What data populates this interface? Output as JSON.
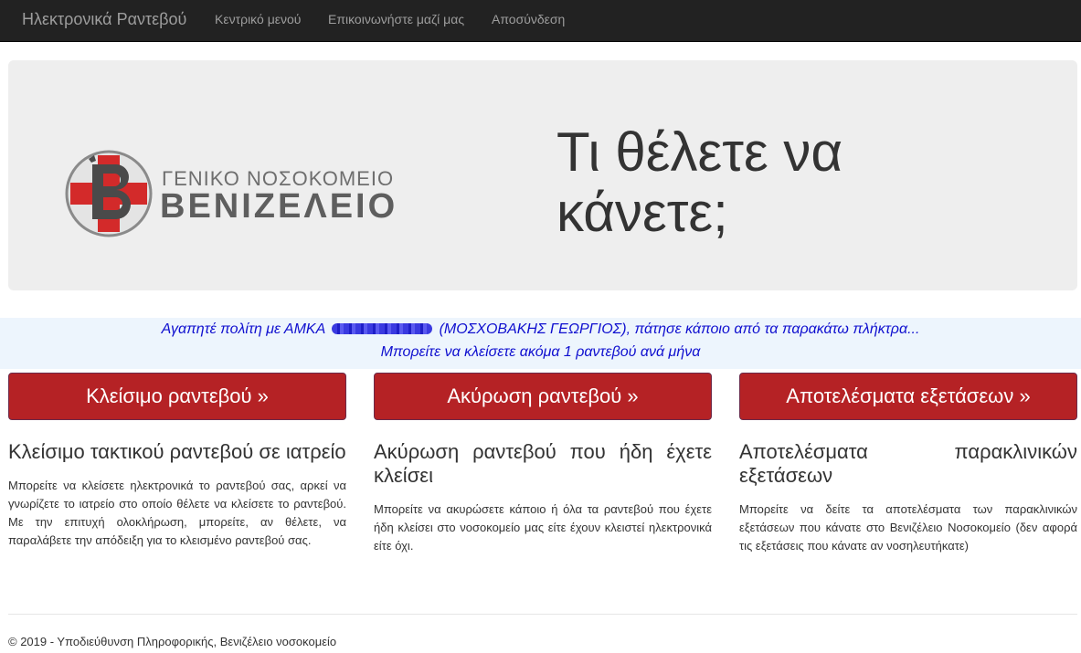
{
  "navbar": {
    "brand": "Ηλεκτρονικά Ραντεβού",
    "links": [
      "Κεντρικό μενού",
      "Επικοινωνήστε μαζί μας",
      "Αποσύνδεση"
    ]
  },
  "jumbotron": {
    "logo_line1": "ΓΕΝΙΚΟ ΝΟΣΟΚΟΜΕΙΟ",
    "logo_line2": "ΒΕΝΙΖΕΛΕΙΟ",
    "headline": "Τι θέλετε να κάνετε;"
  },
  "info": {
    "greeting_prefix": "Αγαπητέ πολίτη με ΑΜΚΑ",
    "greeting_suffix": "(ΜΟΣΧΟΒΑΚΗΣ ΓΕΩΡΓΙΟΣ), πάτησε κάποιο από τα παρακάτω πλήκτρα...",
    "limit_text": "Μπορείτε να κλείσετε ακόμα 1 ραντεβού ανά μήνα"
  },
  "actions": [
    {
      "button": "Κλείσιμο ραντεβού »",
      "title": "Κλείσιμο τακτικού ραντεβού σε ιατρείο",
      "description": "Μπορείτε να κλείσετε ηλεκτρονικά το ραντεβού σας, αρκεί να γνωρίζετε το ιατρείο στο οποίο θέλετε να κλείσετε το ραντεβού. Με την επιτυχή ολοκλήρωση, μπορείτε, αν θέλετε, να παραλάβετε την απόδειξη για το κλεισμένο ραντεβού σας."
    },
    {
      "button": "Ακύρωση ραντεβού »",
      "title": "Ακύρωση ραντεβού που ήδη έχετε κλείσει",
      "description": "Μπορείτε να ακυρώσετε κάποιο ή όλα τα ραντεβού που έχετε ήδη κλείσει στο νοσοκομείο μας είτε έχουν κλειστεί ηλεκτρονικά είτε όχι."
    },
    {
      "button": "Αποτελέσματα εξετάσεων »",
      "title": "Αποτελέσματα παρακλινικών εξετάσεων",
      "description": "Μπορείτε να δείτε τα αποτελέσματα των παρακλινικών εξετάσεων που κάνατε στο Βενιζέλειο Νοσοκομείο (δεν αφορά τις εξετάσεις που κάνατε αν νοσηλευτήκατε)"
    }
  ],
  "footer": "© 2019 - Υποδιεύθυνση Πληροφορικής, Βενιζέλειο νοσοκομείο",
  "colors": {
    "navbar_bg": "#222222",
    "button_red": "#b52225",
    "info_text": "#0f0fcf",
    "info_bg": "#edf5fd"
  }
}
